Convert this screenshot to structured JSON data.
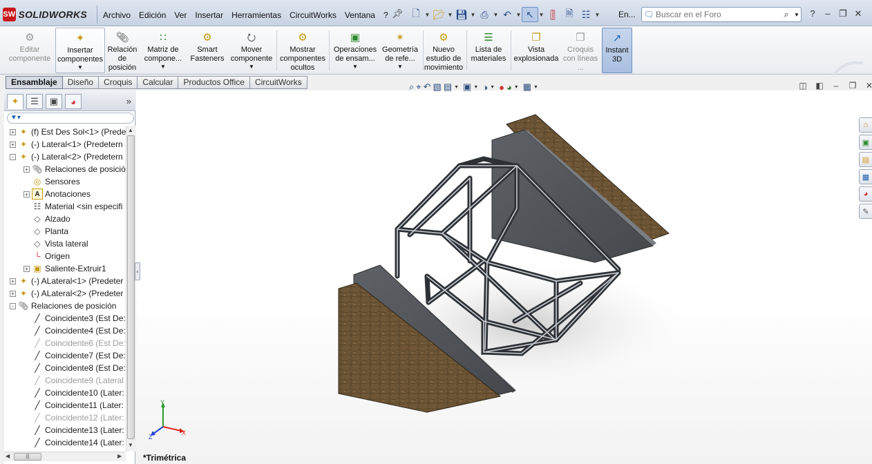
{
  "app": {
    "logo_badge": "SW",
    "logo_text": "SOLIDWORKS",
    "menus": [
      "Archivo",
      "Edición",
      "Ver",
      "Insertar",
      "Herramientas",
      "CircuitWorks",
      "Ventana",
      "?"
    ],
    "en_label": "En...",
    "search_placeholder": "Buscar en el Foro",
    "colors": {
      "ribbon_bg": "#eef1f5",
      "active_tab": "#d6dbe3",
      "wood": "#6e5636",
      "steel": "#6b6f75"
    }
  },
  "quick_access": [
    "new-document-icon",
    "open-icon",
    "save-icon",
    "print-icon",
    "undo-icon",
    "select-icon",
    "rebuild-icon",
    "file-properties-icon",
    "options-icon"
  ],
  "ribbon": {
    "buttons": [
      {
        "label": "Editar componente",
        "icon": "edit-component-icon",
        "disabled": true
      },
      {
        "label": "Insertar componentes",
        "icon": "insert-components-icon",
        "dropdown": true
      },
      {
        "label": "Relación de posición",
        "icon": "mate-icon"
      },
      {
        "label": "Matriz de compone...",
        "icon": "component-pattern-icon",
        "dropdown": true
      },
      {
        "label": "Smart Fasteners",
        "icon": "smart-fasteners-icon"
      },
      {
        "label": "Mover componente",
        "icon": "move-component-icon",
        "dropdown": true
      },
      {
        "label": "Mostrar componentes ocultos",
        "icon": "show-hidden-icon"
      },
      {
        "label": "Operaciones de ensam...",
        "icon": "assembly-features-icon",
        "dropdown": true
      },
      {
        "label": "Geometría de refe...",
        "icon": "reference-geometry-icon",
        "dropdown": true
      },
      {
        "label": "Nuevo estudio de movimiento",
        "icon": "motion-study-icon"
      },
      {
        "label": "Lista de materiales",
        "icon": "bill-of-materials-icon"
      },
      {
        "label": "Vista explosionada",
        "icon": "exploded-view-icon"
      },
      {
        "label": "Croquis con líneas ...",
        "icon": "explode-line-sketch-icon",
        "disabled": true
      },
      {
        "label": "Instant 3D",
        "icon": "instant-3d-icon",
        "pressed": true
      }
    ]
  },
  "tabs": [
    "Ensamblaje",
    "Diseño",
    "Croquis",
    "Calcular",
    "Productos Office",
    "CircuitWorks"
  ],
  "active_tab": "Ensamblaje",
  "tree": {
    "items": [
      {
        "label": "(f) Est Des Sol<1> (Prede",
        "icon": "part-icon",
        "level": 0,
        "expand": "+",
        "dim": false
      },
      {
        "label": "(-) Lateral<1> (Predetern",
        "icon": "part-icon",
        "level": 0,
        "expand": "+",
        "dim": false
      },
      {
        "label": "(-) Lateral<2> (Predetern",
        "icon": "part-icon",
        "level": 0,
        "expand": "-",
        "dim": false
      },
      {
        "label": "Relaciones de posició",
        "icon": "mates-folder-icon",
        "level": 1,
        "expand": "+",
        "dim": false
      },
      {
        "label": "Sensores",
        "icon": "sensor-icon",
        "level": 1,
        "expand": "",
        "dim": false
      },
      {
        "label": "Anotaciones",
        "icon": "annotation-icon",
        "level": 1,
        "expand": "+",
        "dim": false
      },
      {
        "label": "Material <sin especifi",
        "icon": "material-icon",
        "level": 1,
        "expand": "",
        "dim": false
      },
      {
        "label": "Alzado",
        "icon": "plane-icon",
        "level": 1,
        "expand": "",
        "dim": false
      },
      {
        "label": "Planta",
        "icon": "plane-icon",
        "level": 1,
        "expand": "",
        "dim": false
      },
      {
        "label": "Vista lateral",
        "icon": "plane-icon",
        "level": 1,
        "expand": "",
        "dim": false
      },
      {
        "label": "Origen",
        "icon": "origin-icon",
        "level": 1,
        "expand": "",
        "dim": false
      },
      {
        "label": "Saliente-Extruir1",
        "icon": "extrude-icon",
        "level": 1,
        "expand": "+",
        "dim": false
      },
      {
        "label": "(-) ALateral<1> (Predeter",
        "icon": "part-icon",
        "level": 0,
        "expand": "+",
        "dim": false
      },
      {
        "label": "(-) ALateral<2> (Predeter",
        "icon": "part-icon",
        "level": 0,
        "expand": "+",
        "dim": false
      },
      {
        "label": "Relaciones de posición",
        "icon": "mates-folder-icon",
        "level": 0,
        "expand": "-",
        "dim": false
      },
      {
        "label": "Coincidente3 (Est De:",
        "icon": "coincident-icon",
        "level": 1,
        "expand": "",
        "dim": false
      },
      {
        "label": "Coincidente4 (Est De:",
        "icon": "coincident-icon",
        "level": 1,
        "expand": "",
        "dim": false
      },
      {
        "label": "Coincidente6 (Est De:",
        "icon": "coincident-icon",
        "level": 1,
        "expand": "",
        "dim": true
      },
      {
        "label": "Coincidente7 (Est De:",
        "icon": "coincident-icon",
        "level": 1,
        "expand": "",
        "dim": false
      },
      {
        "label": "Coincidente8 (Est De:",
        "icon": "coincident-icon",
        "level": 1,
        "expand": "",
        "dim": false
      },
      {
        "label": "Coincidente9 (Lateral",
        "icon": "coincident-icon",
        "level": 1,
        "expand": "",
        "dim": true
      },
      {
        "label": "Coincidente10 (Later:",
        "icon": "coincident-icon",
        "level": 1,
        "expand": "",
        "dim": false
      },
      {
        "label": "Coincidente11 (Later:",
        "icon": "coincident-icon",
        "level": 1,
        "expand": "",
        "dim": false
      },
      {
        "label": "Coincidente12 (Later:",
        "icon": "coincident-icon",
        "level": 1,
        "expand": "",
        "dim": true
      },
      {
        "label": "Coincidente13 (Later:",
        "icon": "coincident-icon",
        "level": 1,
        "expand": "",
        "dim": false
      },
      {
        "label": "Coincidente14 (Later:",
        "icon": "coincident-icon",
        "level": 1,
        "expand": "",
        "dim": false
      }
    ]
  },
  "viewport": {
    "view_name": "*Trimétrica",
    "triad": {
      "x": "X",
      "y": "Y",
      "z": "Z"
    }
  }
}
